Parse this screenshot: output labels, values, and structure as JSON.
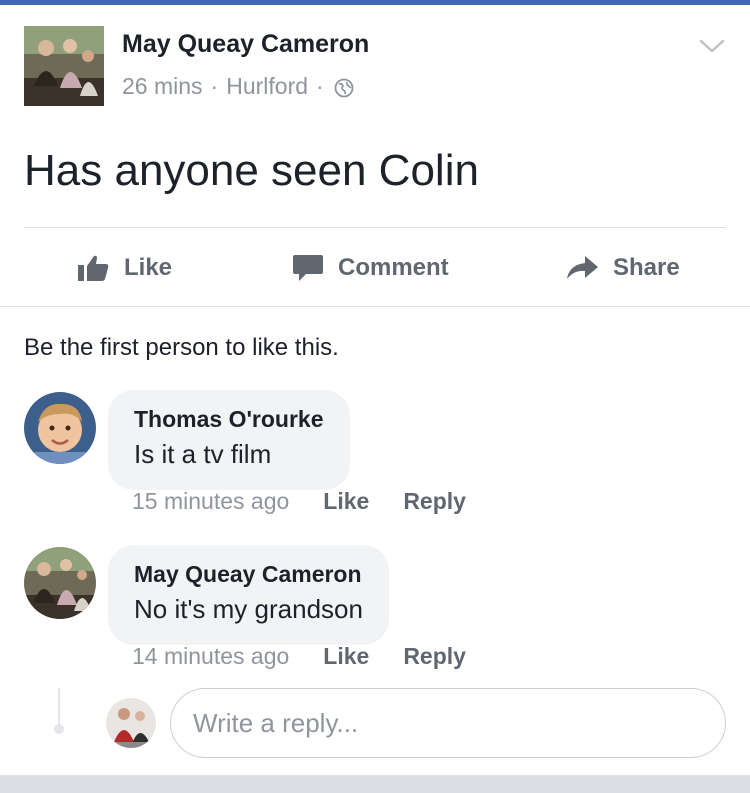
{
  "post": {
    "author": "May Queay Cameron",
    "time": "26 mins",
    "location": "Hurlford",
    "separator": "·",
    "privacy_icon": "globe-icon",
    "menu_icon": "chevron-down-icon",
    "text": "Has anyone seen Colin"
  },
  "actions": {
    "like_label": "Like",
    "comment_label": "Comment",
    "share_label": "Share"
  },
  "likes_summary": "Be the first person to like this.",
  "comments": [
    {
      "author": "Thomas O'rourke",
      "text": "Is it a tv film",
      "time": "15 minutes ago",
      "like_label": "Like",
      "reply_label": "Reply"
    },
    {
      "author": "May Queay Cameron",
      "text": "No it's my grandson",
      "time": "14 minutes ago",
      "like_label": "Like",
      "reply_label": "Reply"
    }
  ],
  "reply": {
    "placeholder": "Write a reply..."
  },
  "colors": {
    "brand": "#4267b2",
    "meta_text": "#90949c",
    "action_text": "#606770",
    "bubble_bg": "#f2f3f5"
  }
}
